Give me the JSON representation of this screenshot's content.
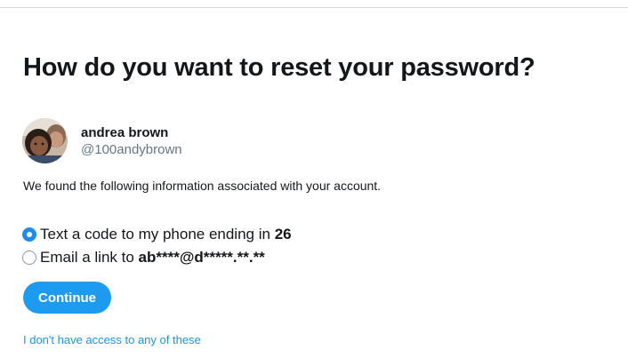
{
  "page": {
    "heading": "How do you want to reset your password?"
  },
  "account": {
    "display_name": "andrea brown",
    "handle": "@100andybrown",
    "avatar_icon": "profile-photo"
  },
  "info_text": "We found the following information associated with your account.",
  "options": [
    {
      "label_prefix": "Text a code to my phone ending in ",
      "label_bold": "26",
      "selected": true
    },
    {
      "label_prefix": "Email a link to ",
      "label_bold": "ab****@d*****.**.**",
      "selected": false
    }
  ],
  "continue_button": {
    "label": "Continue",
    "color": "#1d9bf0"
  },
  "no_access_link": "I don't have access to any of these",
  "colors": {
    "accent": "#1d9bf0",
    "link": "#1b95e0",
    "text": "#14171a",
    "muted": "#657786"
  }
}
